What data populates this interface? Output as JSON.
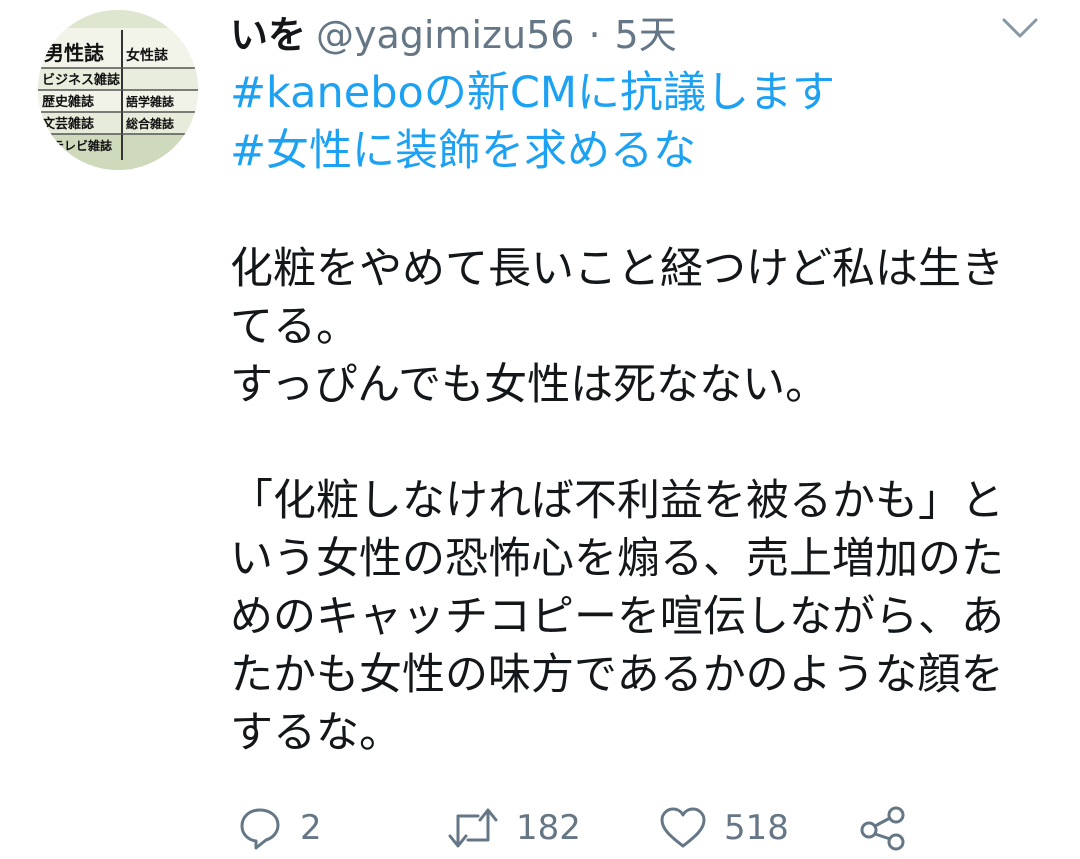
{
  "tweet": {
    "author_name": "いを",
    "handle": "@yagimizu56",
    "separator": "·",
    "timestamp": "5天",
    "avatar_text": [
      "男性誌",
      "女性誌",
      "ビジネス雑誌",
      "歴史雑誌",
      "語学雑誌",
      "文芸雑誌",
      "総合雑誌",
      "テレビ雑誌"
    ],
    "hashtags": [
      "#kaneboの新CMに抗議します",
      "#女性に装飾を求めるな"
    ],
    "body_lines": [
      "化粧をやめて長いこと経つけど私は生き",
      "てる。",
      "すっぴんでも女性は死なない。",
      "",
      "「化粧しなければ不利益を被るかも」と",
      "いう女性の恐怖心を煽る、売上増加のた",
      "めのキャッチコピーを喧伝しながら、あ",
      "たかも女性の味方であるかのような顔を",
      "するな。"
    ],
    "actions": {
      "reply_count": "2",
      "retweet_count": "182",
      "like_count": "518"
    }
  },
  "colors": {
    "link": "#1da1f2",
    "secondary_text": "#657786",
    "primary_text": "#14171a"
  },
  "icons": [
    "caret-down-icon",
    "reply-icon",
    "retweet-icon",
    "like-icon",
    "share-icon"
  ]
}
